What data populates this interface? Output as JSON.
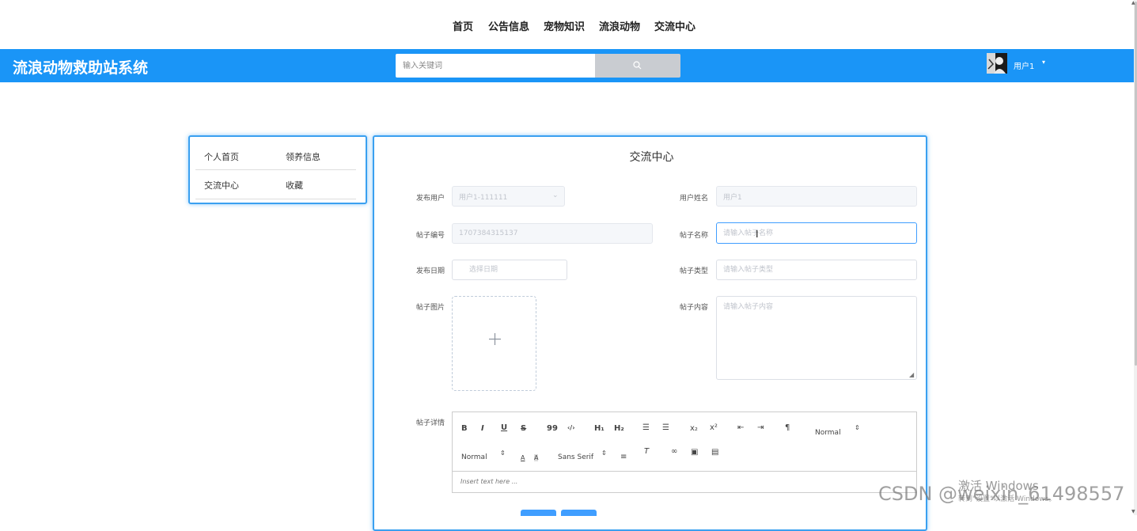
{
  "topnav": {
    "items": [
      "首页",
      "公告信息",
      "宠物知识",
      "流浪动物",
      "交流中心"
    ]
  },
  "header": {
    "brand": "流浪动物救助站系统",
    "search_placeholder": "输入关键词",
    "username": "用户1",
    "bg_color": "#1a95f7"
  },
  "sidebar": {
    "items": [
      {
        "label": "个人首页"
      },
      {
        "label": "领养信息"
      },
      {
        "label": "交流中心"
      },
      {
        "label": "收藏"
      }
    ]
  },
  "form": {
    "title": "交流中心",
    "publisher_label": "发布用户",
    "publisher_value": "用户1-111111",
    "user_name_label": "用户姓名",
    "user_name_value": "用户1",
    "post_no_label": "帖子编号",
    "post_no_value": "1707384315137",
    "post_name_label": "帖子名称",
    "post_name_placeholder": "请输入帖子名称",
    "publish_date_label": "发布日期",
    "publish_date_placeholder": "选择日期",
    "post_type_label": "帖子类型",
    "post_type_placeholder": "请输入帖子类型",
    "post_image_label": "帖子图片",
    "post_content_label": "帖子内容",
    "post_content_placeholder": "请输入帖子内容",
    "post_detail_label": "帖子详情",
    "editor": {
      "bold": "B",
      "italic": "I",
      "underline": "U",
      "strike": "S",
      "blockquote": "99",
      "code": "‹/›",
      "h1": "H₁",
      "h2": "H₂",
      "sub": "x₂",
      "sup": "x²",
      "header_select": "Normal",
      "size_select": "Normal",
      "font_select": "Sans Serif",
      "placeholder": "Insert text here ..."
    }
  },
  "watermark": {
    "activate": "激活 Windows",
    "activate_sub": "转到\"设置\"以激活 Windows。",
    "csdn": "CSDN @weixin_61498557"
  }
}
